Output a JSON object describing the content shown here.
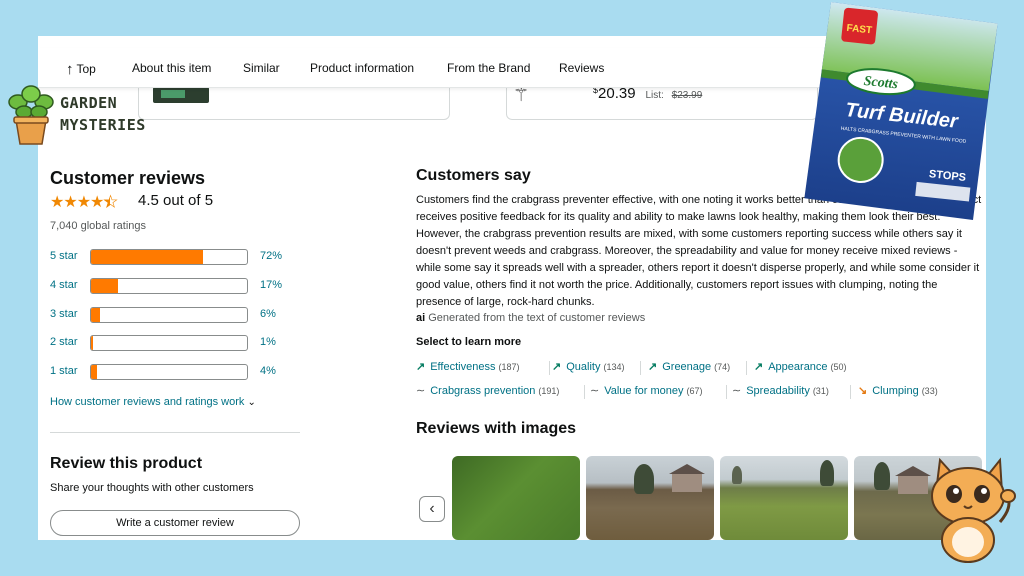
{
  "nav": {
    "top_label": "Top",
    "items": [
      "About this item",
      "Similar",
      "Product information",
      "From the Brand",
      "Reviews"
    ]
  },
  "product_card": {
    "price_currency": "$",
    "price_value": "20.39",
    "list_label": "List:",
    "list_price": "$23.99"
  },
  "logo": {
    "line1": "GARDEN",
    "line2": "MYSTERIES"
  },
  "reviews": {
    "heading": "Customer reviews",
    "stars_value": 4.5,
    "rating_text": "4.5 out of 5",
    "global_ratings": "7,040 global ratings",
    "histogram": [
      {
        "label": "5 star",
        "pct": 72,
        "pct_text": "72%"
      },
      {
        "label": "4 star",
        "pct": 17,
        "pct_text": "17%"
      },
      {
        "label": "3 star",
        "pct": 6,
        "pct_text": "6%"
      },
      {
        "label": "2 star",
        "pct": 1,
        "pct_text": "1%"
      },
      {
        "label": "1 star",
        "pct": 4,
        "pct_text": "4%"
      }
    ],
    "how_link": "How customer reviews and ratings work",
    "review_product_heading": "Review this product",
    "review_product_sub": "Share your thoughts with other customers",
    "write_button": "Write a customer review"
  },
  "customers_say": {
    "heading": "Customers say",
    "text": "Customers find the crabgrass preventer effective, with one noting it works better than other alternatives. The product receives positive feedback for its quality and ability to make lawns look healthy, making them look their best. However, the crabgrass prevention results are mixed, with some customers reporting success while others say it doesn't prevent weeds and crabgrass. Moreover, the spreadability and value for money receive mixed reviews - while some say it spreads well with a spreader, others report it doesn't disperse properly, and while some consider it good value, others find it not worth the price. Additionally, customers report issues with clumping, noting the presence of large, rock-hard chunks.",
    "ai_badge": "ai",
    "ai_note": "Generated from the text of customer reviews",
    "select_label": "Select to learn more",
    "aspects_row1": [
      {
        "label": "Effectiveness",
        "count": "(187)",
        "sentiment": "positive"
      },
      {
        "label": "Quality",
        "count": "(134)",
        "sentiment": "positive"
      },
      {
        "label": "Greenage",
        "count": "(74)",
        "sentiment": "positive"
      },
      {
        "label": "Appearance",
        "count": "(50)",
        "sentiment": "positive"
      }
    ],
    "aspects_row2": [
      {
        "label": "Crabgrass prevention",
        "count": "(191)",
        "sentiment": "mixed"
      },
      {
        "label": "Value for money",
        "count": "(67)",
        "sentiment": "mixed"
      },
      {
        "label": "Spreadability",
        "count": "(31)",
        "sentiment": "mixed"
      },
      {
        "label": "Clumping",
        "count": "(33)",
        "sentiment": "negative"
      }
    ]
  },
  "reviews_with_images": {
    "heading": "Reviews with images",
    "prev_icon": "chevron-left-icon"
  },
  "product_bag": {
    "badge": "FAST",
    "brand": "Scotts",
    "name": "Turf Builder",
    "subtitle": "HALTS CRABGRASS PREVENTER WITH LAWN FOOD",
    "claim": "STOPS"
  },
  "colors": {
    "accent_orange": "#ff7a00",
    "link_teal": "#007185",
    "star_orange": "#f08804",
    "background": "#a9dcf0",
    "deal_red": "#cc0c39"
  }
}
